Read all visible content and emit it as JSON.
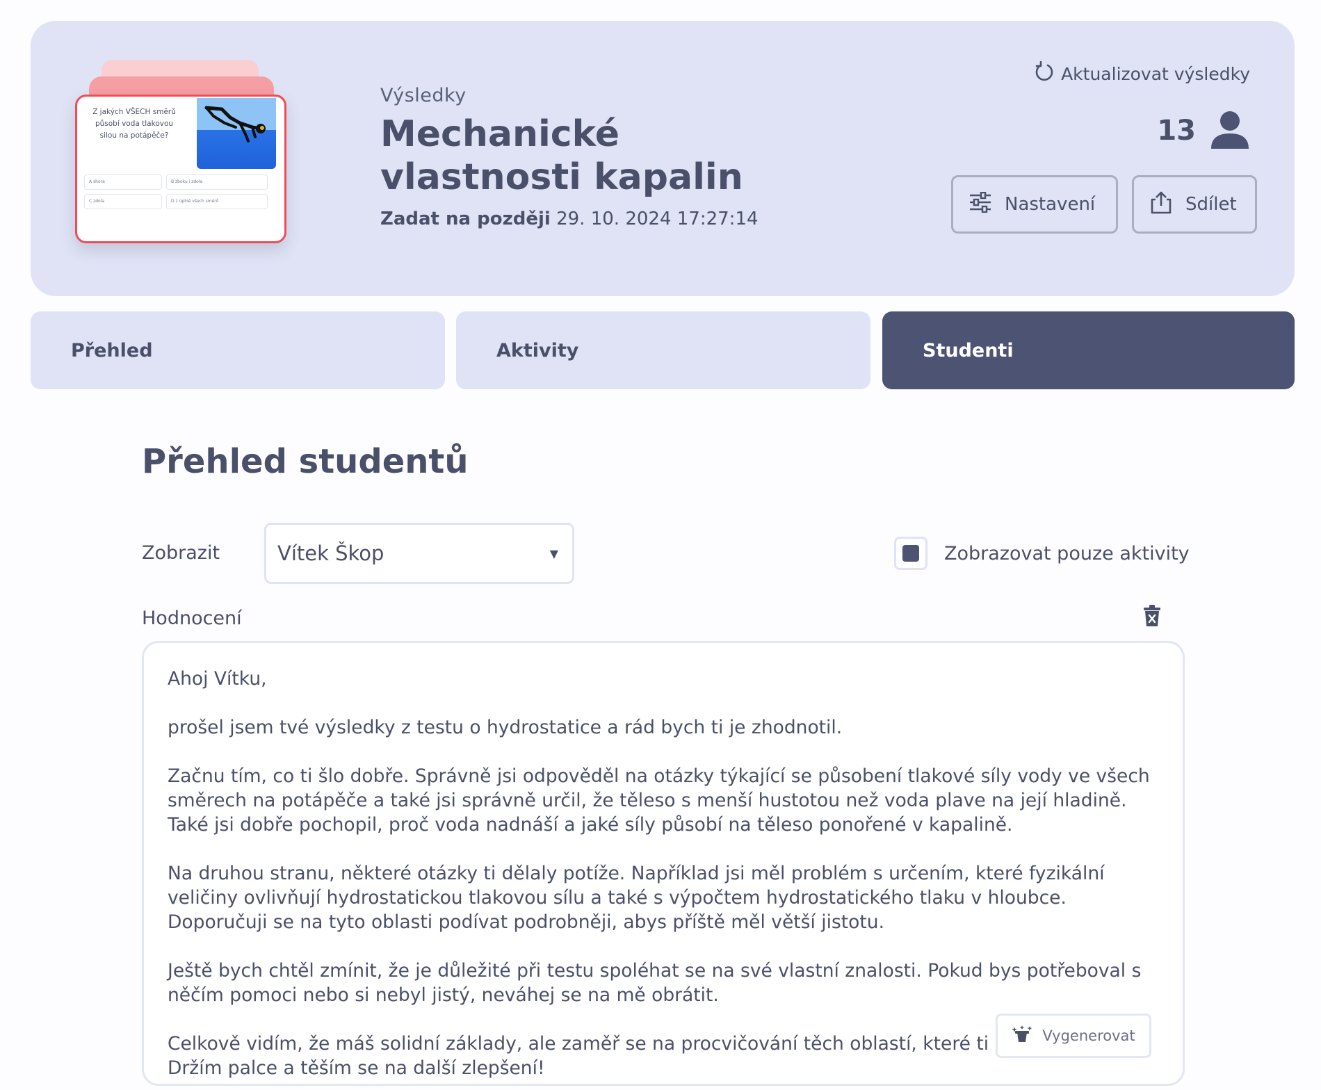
{
  "header": {
    "eyebrow": "Výsledky",
    "title": "Mechanické vlastnosti kapalin",
    "assign_label": "Zadat na později",
    "assign_date": "29. 10. 2024 17:27:14",
    "refresh_label": "Aktualizovat výsledky",
    "student_count": "13",
    "settings_label": "Nastavení",
    "share_label": "Sdílet"
  },
  "thumbnail": {
    "question": "Z jakých VŠECH směrů působí voda tlakovou silou na potápěče?",
    "options": [
      "A shora",
      "B zboku i zdola",
      "C zdola",
      "D z úplně všech směrů"
    ]
  },
  "tabs": [
    {
      "label": "Přehled",
      "active": false
    },
    {
      "label": "Aktivity",
      "active": false
    },
    {
      "label": "Studenti",
      "active": true
    }
  ],
  "students": {
    "section_title": "Přehled studentů",
    "show_label": "Zobrazit",
    "selected_student": "Vítek Škop",
    "only_activities_label": "Zobrazovat pouze aktivity",
    "only_activities_checked": true,
    "evaluation_label": "Hodnocení",
    "feedback_paragraphs": [
      "Ahoj Vítku,",
      "prošel jsem tvé výsledky z testu o hydrostatice a rád bych ti je zhodnotil.",
      "Začnu tím, co ti šlo dobře. Správně jsi odpověděl na otázky týkající se působení tlakové síly vody ve všech\nsměrech na potápěče a také jsi správně určil, že těleso s menší hustotou než voda plave na její hladině.\nTaké jsi dobře pochopil, proč voda nadnáší a jaké síly působí na těleso ponořené v kapalině.",
      "Na druhou stranu, některé otázky ti dělaly potíže. Například jsi měl problém s určením, které fyzikální\nveličiny ovlivňují hydrostatickou tlakovou sílu a také s výpočtem hydrostatického tlaku v hloubce.\nDoporučuji se na tyto oblasti podívat podrobněji, abys příště měl větší jistotu.",
      "Ještě bych chtěl zmínit, že je důležité při testu spoléhat se na své vlastní znalosti. Pokud bys potřeboval s\nněčím pomoci nebo si nebyl jistý, neváhej se na mě obrátit.",
      "Celkově vidím, že máš solidní základy, ale zaměř se na procvičování těch oblastí, které ti\nDržím palce a těším se na další zlepšení!"
    ],
    "generate_label": "Vygenerovat"
  },
  "colors": {
    "header_bg": "#dfe3f5",
    "active_tab": "#4d5473",
    "text": "#4a5069",
    "thumb_accent": "#ef4d56"
  },
  "icons": [
    "refresh-icon",
    "user-icon",
    "sliders-icon",
    "share-icon",
    "trash-icon",
    "magic-hat-icon",
    "caret-down-icon"
  ]
}
